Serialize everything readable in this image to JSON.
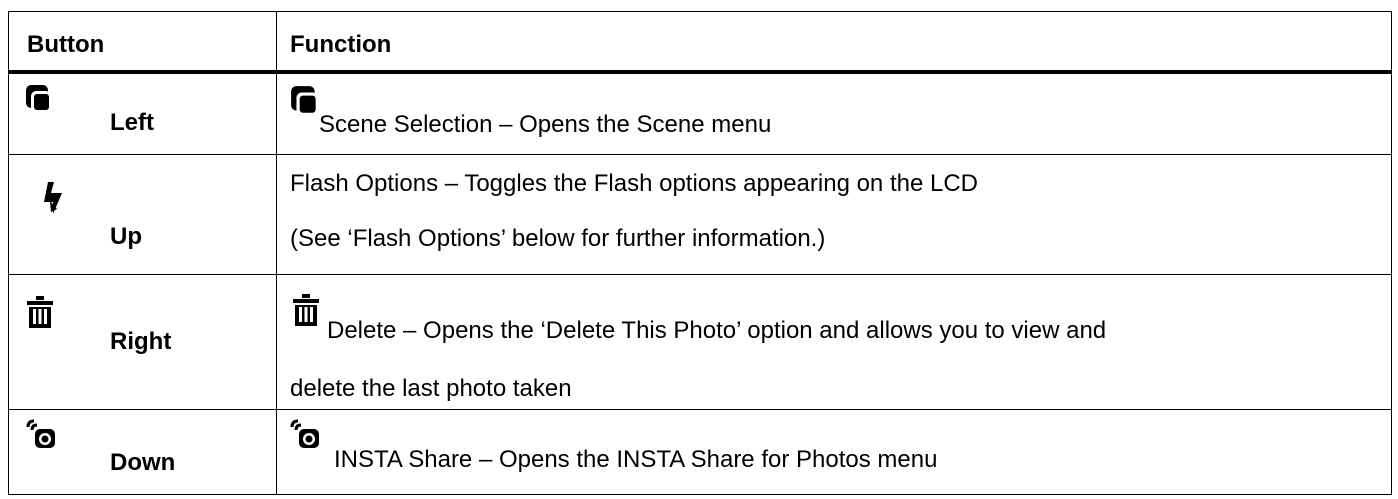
{
  "header": {
    "button": "Button",
    "function": "Function"
  },
  "rows": [
    {
      "button": "Left",
      "icon": "scene-icon",
      "function_lines": [
        "Scene Selection – Opens the Scene menu"
      ]
    },
    {
      "button": "Up",
      "icon": "flash-icon",
      "function_lines": [
        "Flash Options – Toggles the Flash options appearing on the LCD",
        "(See ‘Flash Options’ below for further information.)"
      ]
    },
    {
      "button": "Right",
      "icon": "trash-icon",
      "function_lines": [
        "Delete – Opens the ‘Delete This Photo’ option and allows you to view and",
        "delete the last photo taken"
      ]
    },
    {
      "button": "Down",
      "icon": "insta-share-icon",
      "function_lines": [
        "INSTA Share – Opens the INSTA Share for Photos menu"
      ]
    }
  ]
}
